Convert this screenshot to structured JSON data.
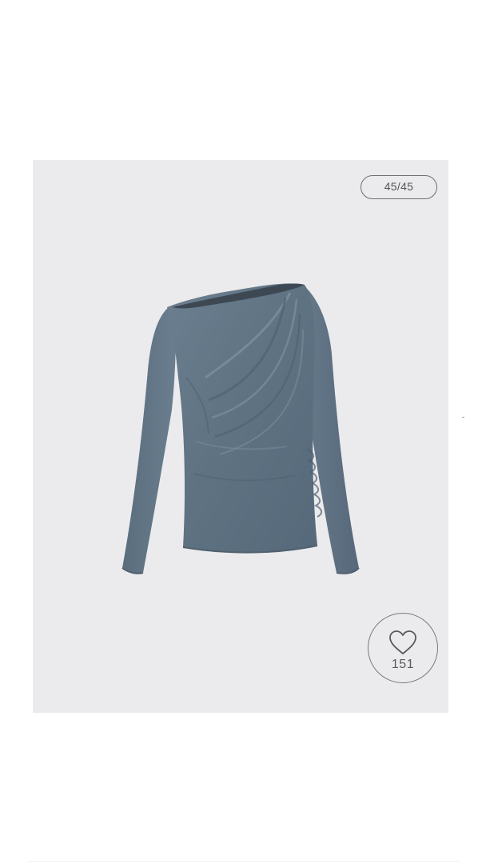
{
  "gallery": {
    "counter_text": "45/45",
    "product_image_alt": "product-photo-off-shoulder-draped-top",
    "product_color": "#5f7282",
    "background_color": "#ebebed"
  },
  "like": {
    "icon": "heart-icon",
    "count": "151"
  }
}
